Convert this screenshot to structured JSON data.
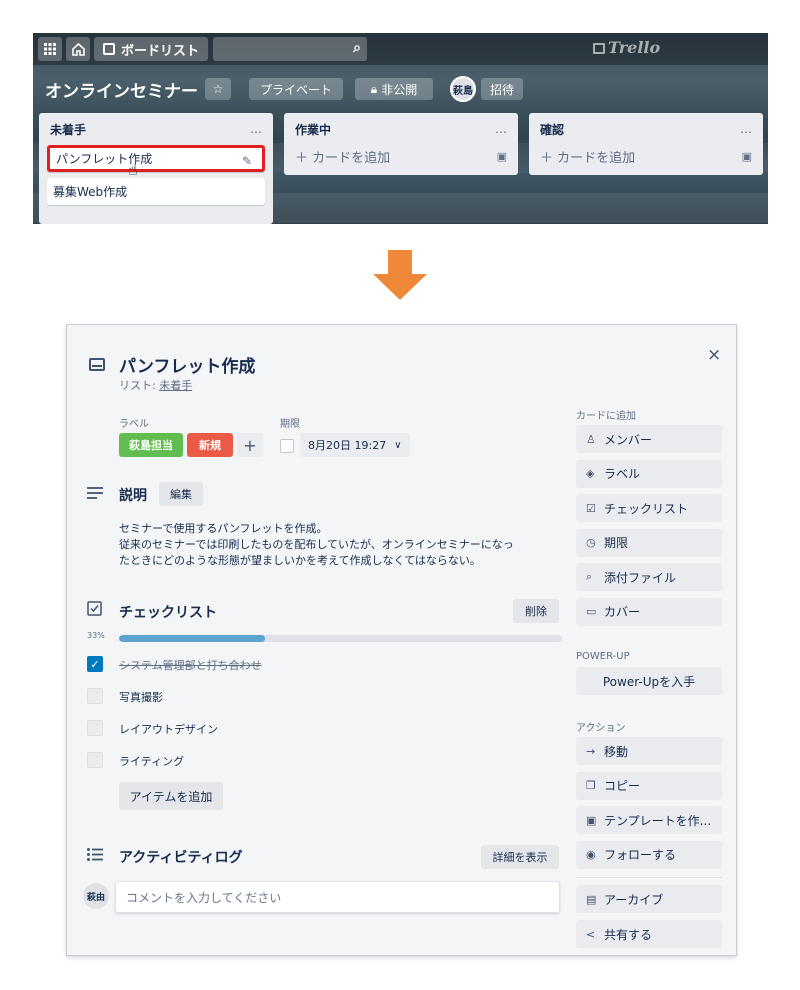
{
  "board": {
    "search_icon": "search-icon",
    "boards_button": "ボードリスト",
    "logo": "Trello",
    "title": "オンラインセミナー",
    "privacy_button": "プライベート",
    "visibility_button": "非公開",
    "member_avatar": "萩島",
    "invite_button": "招待",
    "lists": [
      {
        "name": "未着手",
        "menu": "…",
        "cards": [
          "パンフレット作成",
          "募集Web作成"
        ]
      },
      {
        "name": "作業中",
        "menu": "…",
        "add_card": "＋ カードを追加"
      },
      {
        "name": "確認",
        "menu": "…",
        "add_card": "＋ カードを追加"
      }
    ]
  },
  "modal": {
    "title": "パンフレット作成",
    "list_ref_prefix": "リスト: ",
    "list_ref": "未着手",
    "labels_heading": "ラベル",
    "labels": [
      {
        "text": "萩島担当",
        "color": "#61bd4f"
      },
      {
        "text": "新規",
        "color": "#eb5a46"
      }
    ],
    "add_label": "+",
    "due_heading": "期限",
    "due_date": "8月20日 19:27",
    "description_heading": "説明",
    "edit_button": "編集",
    "description_lines": [
      "セミナーで使用するパンフレットを作成。",
      "従来のセミナーでは印刷したものを配布していたが、オンラインセミナーになっ",
      "たときにどのような形態が望ましいかを考えて作成しなくてはならない。"
    ],
    "checklist_heading": "チェックリスト",
    "delete_button": "削除",
    "progress_label": "33%",
    "progress_value": 33,
    "checklist_items": [
      {
        "text": "システム管理部と打ち合わせ",
        "done": true
      },
      {
        "text": "写真撮影",
        "done": false
      },
      {
        "text": "レイアウトデザイン",
        "done": false
      },
      {
        "text": "ライティング",
        "done": false
      }
    ],
    "add_item_button": "アイテムを追加",
    "activity_heading": "アクティビティログ",
    "show_details_button": "詳細を表示",
    "comment_avatar": "萩由",
    "comment_placeholder": "コメントを入力してください",
    "close_icon": "×"
  },
  "sidebar": {
    "add_to_card_heading": "カードに追加",
    "add_to_card": [
      {
        "icon": "person-icon",
        "glyph": "♙",
        "label": "メンバー"
      },
      {
        "icon": "tag-icon",
        "glyph": "◈",
        "label": "ラベル"
      },
      {
        "icon": "checklist-icon",
        "glyph": "☑",
        "label": "チェックリスト"
      },
      {
        "icon": "clock-icon",
        "glyph": "◷",
        "label": "期限"
      },
      {
        "icon": "paperclip-icon",
        "glyph": "⌕",
        "label": "添付ファイル"
      },
      {
        "icon": "cover-icon",
        "glyph": "▭",
        "label": "カバー"
      }
    ],
    "powerup_heading": "POWER-UP",
    "powerup_button": "Power-Upを入手",
    "actions_heading": "アクション",
    "actions": [
      {
        "icon": "arrow-right-icon",
        "glyph": "→",
        "label": "移動"
      },
      {
        "icon": "copy-icon",
        "glyph": "❐",
        "label": "コピー"
      },
      {
        "icon": "template-icon",
        "glyph": "▣",
        "label": "テンプレートを作..."
      },
      {
        "icon": "eye-icon",
        "glyph": "◉",
        "label": "フォローする"
      },
      {
        "icon": "archive-icon",
        "glyph": "▤",
        "label": "アーカイブ"
      },
      {
        "icon": "share-icon",
        "glyph": "<",
        "label": "共有する"
      }
    ]
  }
}
